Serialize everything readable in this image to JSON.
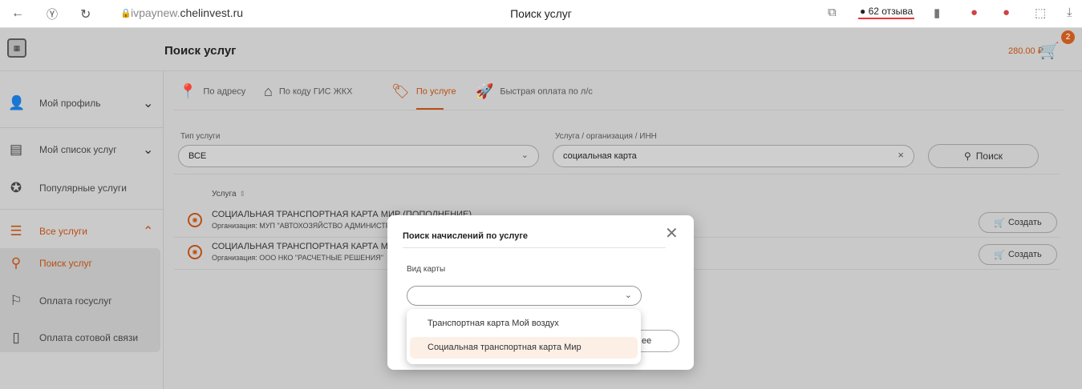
{
  "browser": {
    "url_host_prefix": "ivpaynew.",
    "url_host": "chelinvest.ru",
    "tab_title": "Поиск услуг",
    "reviews": "62 отзыва"
  },
  "header": {
    "title": "Поиск услуг",
    "cart_sum": "280.00 ₽",
    "cart_count": "2"
  },
  "sidebar": {
    "items": [
      {
        "label": "Мой профиль"
      },
      {
        "label": "Мой список услуг"
      },
      {
        "label": "Популярные услуги"
      },
      {
        "label": "Все услуги"
      },
      {
        "label": "Поиск услуг"
      },
      {
        "label": "Оплата госуслуг"
      },
      {
        "label": "Оплата сотовой связи"
      }
    ]
  },
  "tabs": [
    {
      "label": "По адресу"
    },
    {
      "label": "По коду ГИС ЖКХ"
    },
    {
      "label": "По услуге"
    },
    {
      "label": "Быстрая оплата по л/с"
    }
  ],
  "filters": {
    "type_label": "Тип услуги",
    "type_value": "ВСЕ",
    "query_label": "Услуга / организация / ИНН",
    "query_value": "социальная карта",
    "search_button": "Поиск"
  },
  "table": {
    "column": "Услуга",
    "rows": [
      {
        "title": "СОЦИАЛЬНАЯ ТРАНСПОРТНАЯ КАРТА МИР (ПОПОЛНЕНИЕ)",
        "org": "Организация: МУП \"АВТОХОЗЯЙСТВО АДМИНИСТРАЦИИ\"",
        "action": "Создать"
      },
      {
        "title": "СОЦИАЛЬНАЯ ТРАНСПОРТНАЯ КАРТА МИР",
        "org": "Организация: ООО НКО \"РАСЧЕТНЫЕ РЕШЕНИЯ\"",
        "action": "Создать"
      }
    ]
  },
  "modal": {
    "title": "Поиск начислений по услуге",
    "field_label": "Вид карты",
    "button": "ее",
    "options": [
      "Транспортная карта Мой воздух",
      "Социальная транспортная карта Мир"
    ]
  },
  "colors": {
    "accent": "#b94f14"
  }
}
